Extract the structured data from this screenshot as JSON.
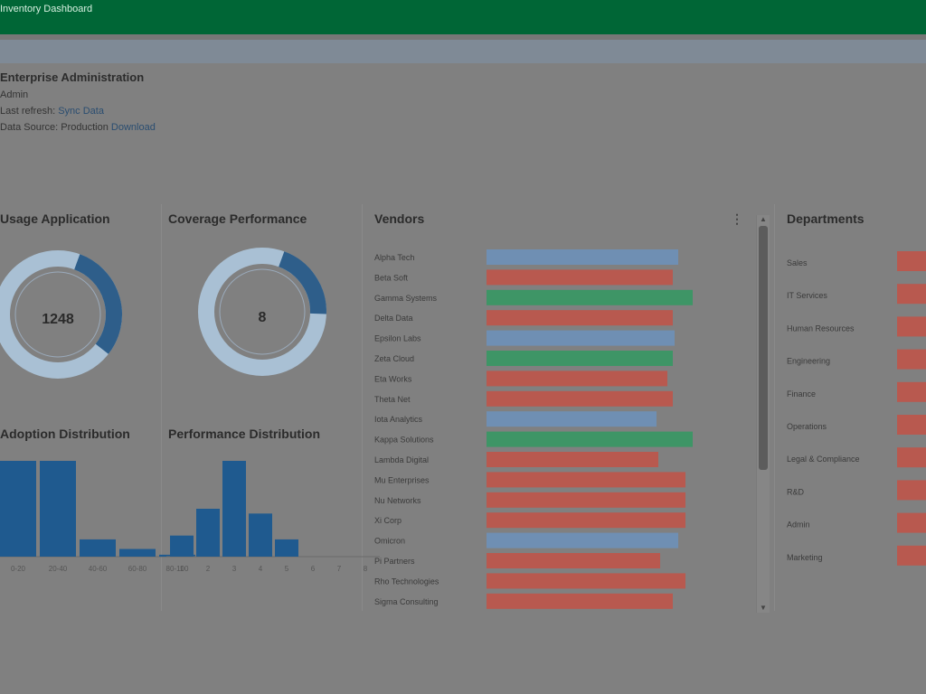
{
  "app": {
    "title": "Inventory Dashboard"
  },
  "header": {
    "title": "Enterprise Administration",
    "line1": "Admin",
    "line2_label": "Last refresh: ",
    "line2_link": "Sync Data",
    "line3_label": "Data Source: Production ",
    "line3_link": "Download"
  },
  "cards": {
    "donut1": {
      "title": "Usage Application",
      "center": "1248",
      "fraction": 0.3
    },
    "donut2": {
      "title": "Coverage Performance",
      "center": "8",
      "fraction": 0.2
    },
    "hist1": {
      "title": "Adoption Distribution"
    },
    "hist2": {
      "title": "Performance Distribution"
    },
    "bars": {
      "title": "Vendors"
    },
    "right": {
      "title": "Departments"
    }
  },
  "colors": {
    "blue": "#6f8fb3",
    "red": "#b8594f",
    "green": "#3e9566",
    "dark_blue": "#1f5a8f",
    "donut_light": "#a9c0d4",
    "donut_dark": "#2e5e8a"
  },
  "chart_data": [
    {
      "type": "bar",
      "title": "Adoption Distribution",
      "categories": [
        "0-20",
        "20-40",
        "40-60",
        "60-80",
        "80-100"
      ],
      "values": [
        100,
        100,
        18,
        8,
        2
      ]
    },
    {
      "type": "bar",
      "title": "Performance Distribution",
      "categories": [
        "1",
        "2",
        "3",
        "4",
        "5",
        "6",
        "7",
        "8"
      ],
      "values": [
        22,
        50,
        100,
        45,
        18,
        0,
        0,
        0
      ]
    },
    {
      "type": "bar",
      "orientation": "horizontal",
      "title": "Vendors",
      "categories": [
        "Alpha Tech",
        "Beta Soft",
        "Gamma Systems",
        "Delta Data",
        "Epsilon Labs",
        "Zeta Cloud",
        "Eta Works",
        "Theta Net",
        "Iota Analytics",
        "Kappa Solutions",
        "Lambda Digital",
        "Mu Enterprises",
        "Nu Networks",
        "Xi Corp",
        "Omicron",
        "Pi Partners",
        "Rho Technologies",
        "Sigma Consulting"
      ],
      "values": [
        212,
        206,
        228,
        206,
        208,
        206,
        200,
        206,
        188,
        228,
        190,
        220,
        220,
        220,
        212,
        192,
        220,
        206
      ],
      "colors": [
        "blue",
        "red",
        "green",
        "red",
        "blue",
        "green",
        "red",
        "red",
        "blue",
        "green",
        "red",
        "red",
        "red",
        "red",
        "blue",
        "red",
        "red",
        "red"
      ]
    },
    {
      "type": "bar",
      "orientation": "horizontal",
      "title": "Departments",
      "categories": [
        "Sales",
        "IT Services",
        "Human Resources",
        "Engineering",
        "Finance",
        "Operations",
        "Legal & Compliance",
        "R&D",
        "Admin",
        "Marketing"
      ],
      "values": [
        40,
        40,
        40,
        40,
        40,
        40,
        40,
        40,
        40,
        40
      ]
    }
  ]
}
